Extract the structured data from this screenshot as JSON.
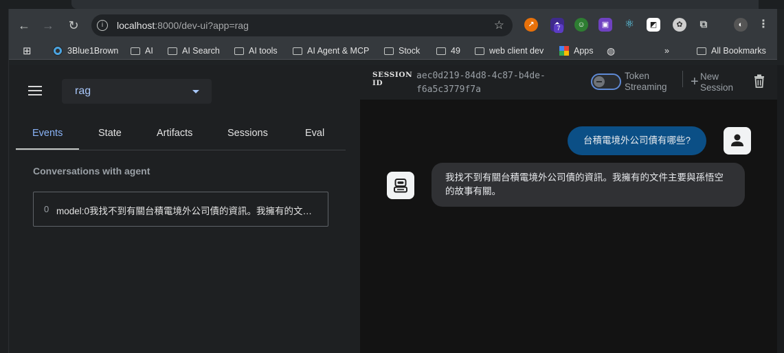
{
  "browser": {
    "url_host": "localhost",
    "url_rest": ":8000/dev-ui?app=rag",
    "extension_badge": "7",
    "bookmarks": [
      {
        "label": "3Blue1Brown",
        "icon": "3b1b-icon"
      },
      {
        "label": "AI",
        "icon": "folder-icon"
      },
      {
        "label": "AI Search",
        "icon": "folder-icon"
      },
      {
        "label": "AI tools",
        "icon": "folder-icon"
      },
      {
        "label": "AI Agent & MCP",
        "icon": "folder-icon"
      },
      {
        "label": "Stock",
        "icon": "folder-icon"
      },
      {
        "label": "49",
        "icon": "folder-icon"
      },
      {
        "label": "web client dev",
        "icon": "folder-icon"
      },
      {
        "label": "Apps",
        "icon": "apps-grid-icon"
      },
      {
        "label": "",
        "icon": "globe-icon"
      }
    ],
    "overflow_label": "»",
    "all_bookmarks": "All Bookmarks"
  },
  "sidebar": {
    "app_name": "rag",
    "tabs": [
      "Events",
      "State",
      "Artifacts",
      "Sessions",
      "Eval"
    ],
    "active_tab": "Events",
    "section_title": "Conversations with agent",
    "events": [
      {
        "index": "0",
        "text": "model:0我找不到有關台積電境外公司債的資訊。我擁有的文件主要與孫悟空的故事有關。"
      }
    ]
  },
  "session": {
    "label_line1": "SESSION",
    "label_line2": "ID",
    "id_line1": "aec0d219-84d8-4c87-b4de-",
    "id_line2": "f6a5c3779f7a",
    "token_streaming_line1": "Token",
    "token_streaming_line2": "Streaming",
    "new_session_line1": "New",
    "new_session_line2": "Session"
  },
  "chat": {
    "user_message": "台積電境外公司債有哪些?",
    "bot_message": "我找不到有關台積電境外公司債的資訊。我擁有的文件主要與孫悟空的故事有關。"
  },
  "colors": {
    "accent": "#8ab4f8",
    "user_bubble": "#0b4f86",
    "bot_bubble": "#303134"
  }
}
